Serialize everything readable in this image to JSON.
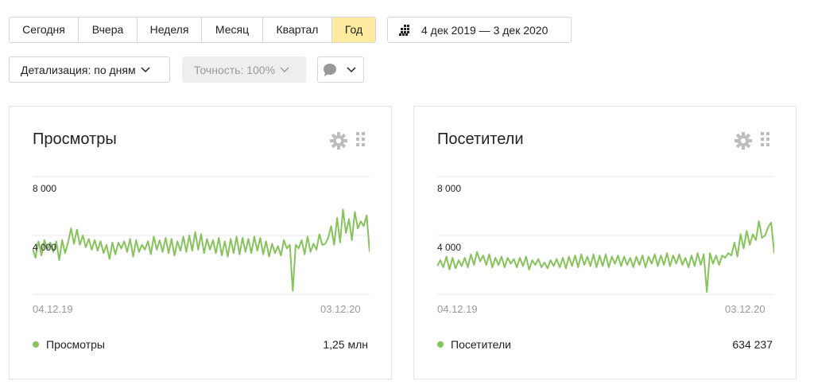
{
  "periods": [
    {
      "label": "Сегодня",
      "active": false
    },
    {
      "label": "Вчера",
      "active": false
    },
    {
      "label": "Неделя",
      "active": false
    },
    {
      "label": "Месяц",
      "active": false
    },
    {
      "label": "Квартал",
      "active": false
    },
    {
      "label": "Год",
      "active": true
    }
  ],
  "date_range": "4 дек 2019 — 3 дек 2020",
  "detail": {
    "label": "Детализация: по дням"
  },
  "accuracy": {
    "label": "Точность: 100%"
  },
  "colors": {
    "accent": "#ffeba0",
    "series": "#86c35b",
    "grid": "#e6e6e6",
    "axis_text": "#999999"
  },
  "widgets": [
    {
      "title": "Просмотры",
      "ticks": [
        "8 000",
        "4 000"
      ],
      "x_start": "04.12.19",
      "x_end": "03.12.20",
      "legend": "Просмотры",
      "total": "1,25 млн"
    },
    {
      "title": "Посетители",
      "ticks": [
        "8 000",
        "4 000"
      ],
      "x_start": "04.12.19",
      "x_end": "03.12.20",
      "legend": "Посетители",
      "total": "634 237"
    }
  ],
  "chart_data": [
    {
      "type": "line",
      "title": "Просмотры",
      "x": [
        "04.12.19",
        "03.12.20"
      ],
      "ylim": [
        0,
        10000
      ],
      "grid": true,
      "series": [
        {
          "name": "Просмотры",
          "values": [
            3900,
            3100,
            4500,
            3300,
            4600,
            3800,
            4400,
            3600,
            4500,
            2900,
            4600,
            3500,
            4400,
            5600,
            4300,
            5500,
            4200,
            5000,
            4000,
            4700,
            3800,
            4600,
            3700,
            4500,
            3500,
            4200,
            3000,
            4400,
            3400,
            4400,
            3900,
            4500,
            3600,
            4700,
            3200,
            4600,
            3600,
            4200,
            3800,
            4500,
            3400,
            4900,
            3800,
            4600,
            3600,
            4800,
            3500,
            4700,
            3300,
            4500,
            3700,
            4900,
            3600,
            5000,
            3700,
            5300,
            3800,
            5100,
            3500,
            4700,
            3800,
            4600,
            3500,
            4800,
            3300,
            4500,
            3200,
            4700,
            3500,
            4900,
            3400,
            4800,
            3600,
            4700,
            3500,
            4900,
            3700,
            4800,
            3400,
            4500,
            3200,
            4300,
            3500,
            4100,
            3300,
            4600,
            3900,
            4200,
            300,
            4200,
            3900,
            4600,
            3400,
            4900,
            3600,
            4300,
            3800,
            5100,
            4200,
            4300,
            4800,
            5800,
            4200,
            6500,
            4400,
            7200,
            5200,
            6400,
            4600,
            7000,
            5600,
            6200,
            5800,
            6700,
            3600
          ]
        }
      ]
    },
    {
      "type": "line",
      "title": "Посетители",
      "x": [
        "04.12.19",
        "03.12.20"
      ],
      "ylim": [
        0,
        10000
      ],
      "grid": true,
      "series": [
        {
          "name": "Посетители",
          "values": [
            2400,
            2900,
            2300,
            3200,
            2100,
            3100,
            2200,
            2900,
            2400,
            3100,
            2300,
            3400,
            2500,
            3600,
            2800,
            3300,
            2500,
            3400,
            2300,
            3100,
            2500,
            3200,
            2300,
            3100,
            2600,
            3000,
            2300,
            3100,
            2400,
            3200,
            2100,
            2900,
            2500,
            3000,
            2300,
            2700,
            2200,
            2900,
            2400,
            3000,
            2300,
            3100,
            2200,
            3200,
            2400,
            3300,
            2300,
            3400,
            2500,
            3200,
            2400,
            3400,
            2300,
            3300,
            2400,
            3400,
            2300,
            3200,
            2600,
            3300,
            2400,
            3200,
            2500,
            3100,
            2300,
            3200,
            2500,
            3300,
            2300,
            3200,
            2600,
            3400,
            2400,
            3300,
            2500,
            3500,
            2400,
            3300,
            2600,
            3400,
            2500,
            3100,
            2300,
            3300,
            2400,
            3500,
            2500,
            3400,
            200,
            3500,
            2600,
            3300,
            2500,
            3300,
            3100,
            3500,
            3300,
            4400,
            3200,
            5100,
            3900,
            5400,
            4200,
            5100,
            4600,
            6200,
            4800,
            5000,
            5700,
            6100,
            3500
          ]
        }
      ]
    }
  ]
}
